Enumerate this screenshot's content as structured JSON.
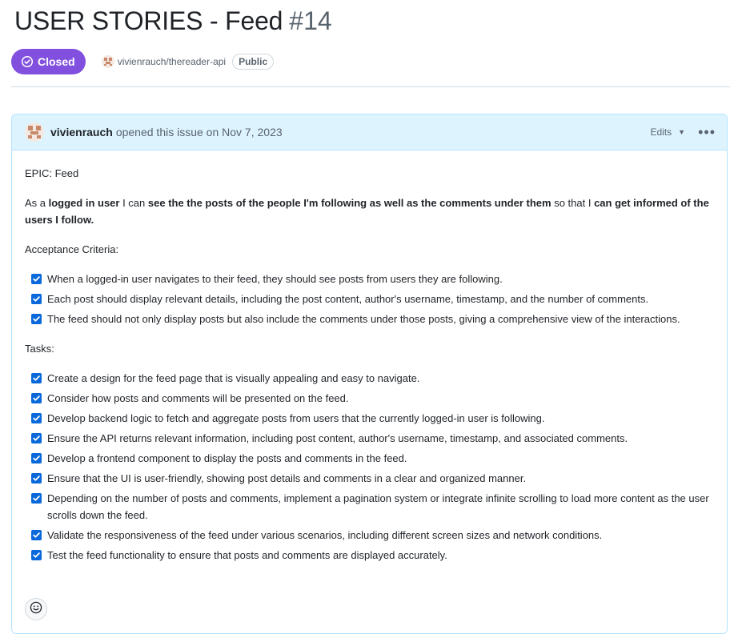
{
  "issue": {
    "title": "USER STORIES - Feed",
    "number": "#14",
    "state": "Closed",
    "state_color": "#8250df",
    "repo": "vivienrauch/thereader-api",
    "visibility": "Public"
  },
  "comment": {
    "author": "vivienrauch",
    "opened_text": "opened this issue on Nov 7, 2023",
    "edits_label": "Edits",
    "menu_icon": "kebab-horizontal-icon",
    "epic_line": "EPIC: Feed",
    "story": {
      "p1": "As a ",
      "b1": "logged in user",
      "p2": " I can ",
      "b2": "see the the posts of the people I'm following as well as the comments under them",
      "p3": " so that I ",
      "b3": "can get informed of the users I follow."
    },
    "acceptance_heading": "Acceptance Criteria:",
    "acceptance_items": [
      "When a logged-in user navigates to their feed, they should see posts from users they are following.",
      "Each post should display relevant details, including the post content, author's username, timestamp, and the number of comments.",
      "The feed should not only display posts but also include the comments under those posts, giving a comprehensive view of the interactions."
    ],
    "tasks_heading": "Tasks:",
    "task_items": [
      "Create a design for the feed page that is visually appealing and easy to navigate.",
      "Consider how posts and comments will be presented on the feed.",
      "Develop backend logic to fetch and aggregate posts from users that the currently logged-in user is following.",
      "Ensure the API returns relevant information, including post content, author's username, timestamp, and associated comments.",
      "Develop a frontend component to display the posts and comments in the feed.",
      "Ensure that the UI is user-friendly, showing post details and comments in a clear and organized manner.",
      "Depending on the number of posts and comments, implement a pagination system or integrate infinite scrolling to load more content as the user scrolls down the feed.",
      "Validate the responsiveness of the feed under various scenarios, including different screen sizes and network conditions.",
      "Test the feed functionality to ensure that posts and comments are displayed accurately."
    ],
    "reaction_icon": "smiley-icon"
  }
}
